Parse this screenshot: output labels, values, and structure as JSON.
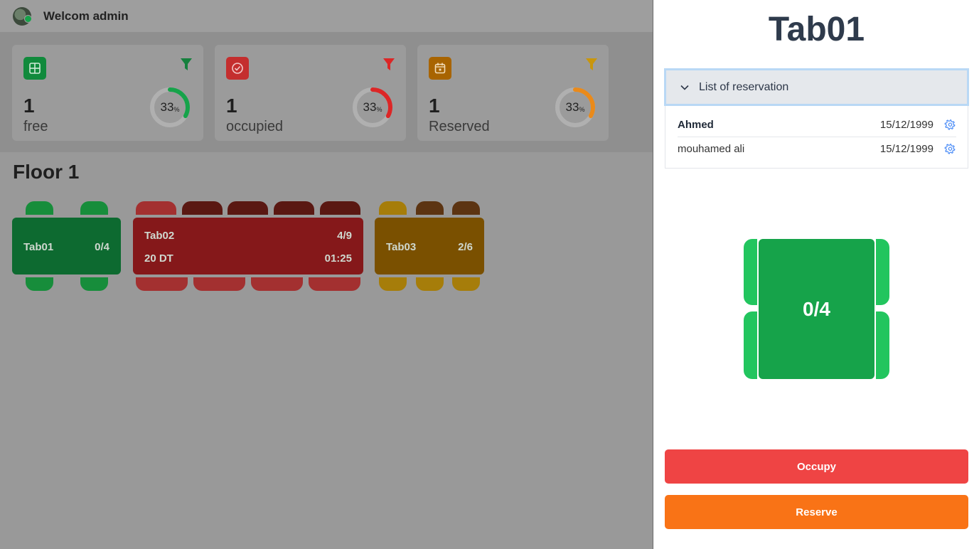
{
  "header": {
    "welcome": "Welcom admin"
  },
  "stats": [
    {
      "count": "1",
      "label": "free",
      "percent": 33,
      "percent_text": "33",
      "percent_unit": "%",
      "color": "#16a34a",
      "filter_color": "#15803d",
      "icon": "table-grid-icon"
    },
    {
      "count": "1",
      "label": "occupied",
      "percent": 33,
      "percent_text": "33",
      "percent_unit": "%",
      "color": "#dc2626",
      "filter_color": "#dc2626",
      "icon": "check-badge-icon"
    },
    {
      "count": "1",
      "label": "Reserved",
      "percent": 33,
      "percent_text": "33",
      "percent_unit": "%",
      "color": "#ea8a1a",
      "filter_color": "#d4a017",
      "icon": "calendar-icon"
    }
  ],
  "floor": {
    "title": "Floor 1",
    "tables": [
      {
        "name": "Tab01",
        "count": "0/4",
        "status": "free"
      },
      {
        "name": "Tab02",
        "count": "4/9",
        "price": "20 DT",
        "time": "01:25",
        "status": "occupied"
      },
      {
        "name": "Tab03",
        "count": "2/6",
        "status": "reserved"
      }
    ]
  },
  "panel": {
    "title": "Tab01",
    "accordion_label": "List of reservation",
    "reservations": [
      {
        "name": "Ahmed",
        "date": "15/12/1999"
      },
      {
        "name": "mouhamed ali",
        "date": "15/12/1999"
      }
    ],
    "table_count": "0/4",
    "occupy_label": "Occupy",
    "reserve_label": "Reserve"
  },
  "colors": {
    "free": "#16a34a",
    "occupied": "#ef4444",
    "reserved": "#f97316",
    "accent_border": "#b9d8f5"
  }
}
